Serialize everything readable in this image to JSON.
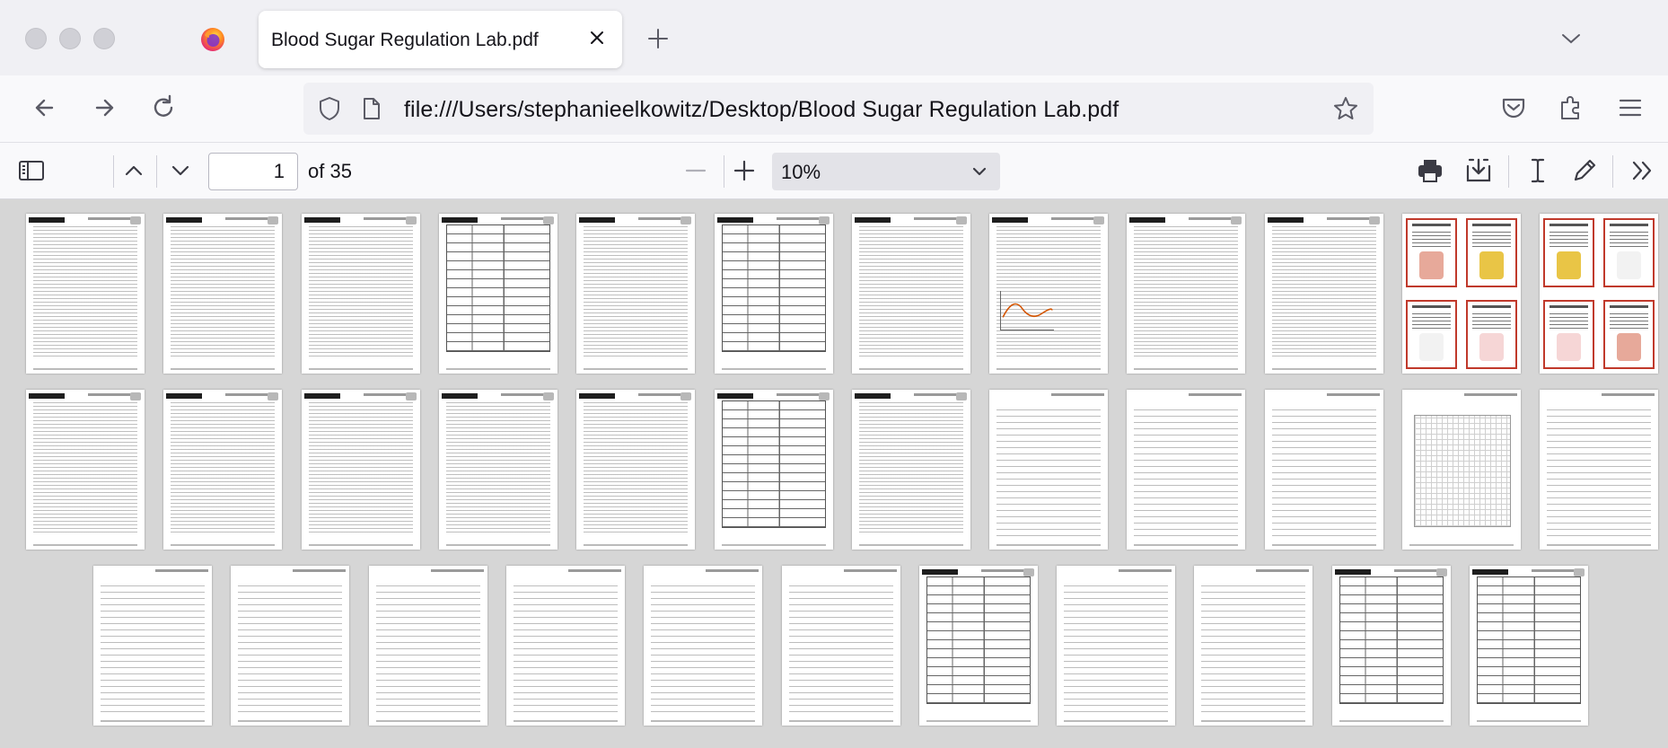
{
  "tab": {
    "title": "Blood Sugar Regulation Lab.pdf"
  },
  "url": {
    "value": "file:///Users/stephanieelkowitz/Desktop/Blood Sugar Regulation Lab.pdf"
  },
  "pdf_toolbar": {
    "page_number": "1",
    "page_count": "of 35",
    "zoom_value": "10%"
  },
  "icons": {
    "back": "arrow-left-icon",
    "forward": "arrow-right-icon",
    "reload": "reload-icon",
    "shield": "shield-icon",
    "page": "page-icon",
    "bookmark": "star-icon",
    "pocket": "pocket-icon",
    "extensions": "puzzle-icon",
    "menu": "hamburger-icon",
    "sidebar": "sidebar-toggle-icon",
    "prev_page": "chevron-up-icon",
    "next_page": "chevron-down-icon",
    "zoom_out": "minus-icon",
    "zoom_in": "plus-icon",
    "print": "printer-icon",
    "save": "download-icon",
    "text_tool": "text-cursor-icon",
    "draw": "pen-icon",
    "more": "double-chevron-icon"
  },
  "colors": {
    "card_border": "#c0392b",
    "accent": "#0060df"
  },
  "thumbnails": {
    "row1": [
      "text",
      "text",
      "text",
      "table",
      "text",
      "table",
      "text",
      "text",
      "text",
      "text",
      "cards",
      "cards"
    ],
    "row2": [
      "text",
      "text",
      "text",
      "text",
      "text",
      "table",
      "text",
      "rules",
      "rules",
      "rules",
      "grid",
      "rules"
    ],
    "row3": [
      "rules",
      "rules",
      "rules",
      "rules",
      "rules",
      "rules",
      "table",
      "rules",
      "rules",
      "table",
      "table"
    ]
  }
}
